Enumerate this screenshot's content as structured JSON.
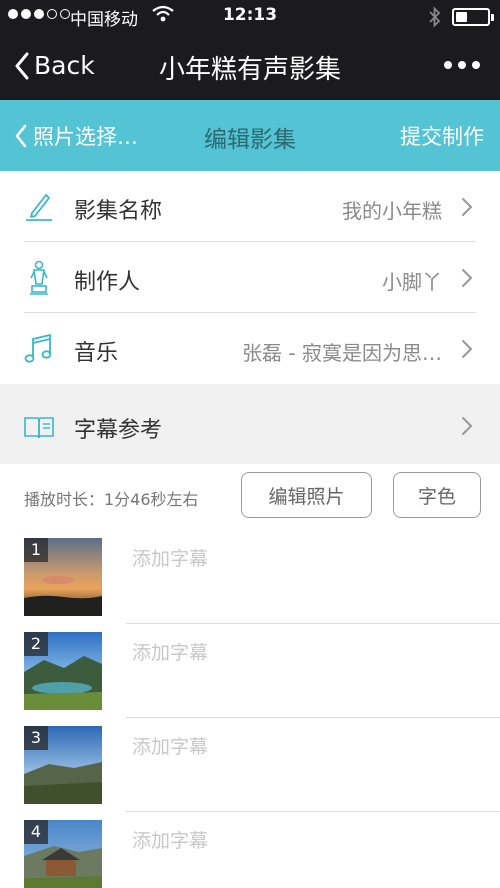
{
  "status_bar": {
    "carrier": "中国移动",
    "time": "12:13",
    "battery_level": 0.35
  },
  "nav": {
    "back_label": "Back",
    "title": "小年糕有声影集"
  },
  "sub_header": {
    "back_label": "照片选择…",
    "title": "编辑影集",
    "submit_label": "提交制作"
  },
  "settings": [
    {
      "label": "影集名称",
      "value": "我的小年糕",
      "icon": "pen-icon"
    },
    {
      "label": "制作人",
      "value": "小脚丫",
      "icon": "oscar-statue-icon"
    },
    {
      "label": "音乐",
      "value": "张磊 - 寂寞是因为思…",
      "icon": "music-note-icon"
    }
  ],
  "subtitle_ref": {
    "label": "字幕参考",
    "icon": "book-icon"
  },
  "duration": {
    "text": "播放时长：1分46秒左右"
  },
  "buttons": {
    "edit_photos": "编辑照片",
    "font_color": "字色"
  },
  "photos": [
    {
      "number": "1",
      "placeholder": "添加字幕"
    },
    {
      "number": "2",
      "placeholder": "添加字幕"
    },
    {
      "number": "3",
      "placeholder": "添加字幕"
    },
    {
      "number": "4",
      "placeholder": "添加字幕"
    }
  ],
  "colors": {
    "bar": "#1b1b1d",
    "accent": "#54c3d3",
    "icon": "#3bb7c9"
  }
}
